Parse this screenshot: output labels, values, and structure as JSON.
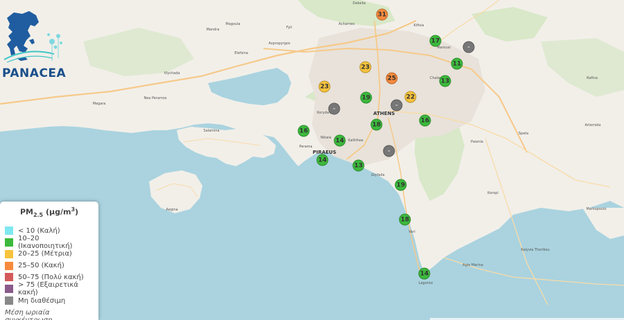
{
  "brand": {
    "name": "PANACEA"
  },
  "legend": {
    "title_main": "PM",
    "title_sub": "2.5",
    "title_unit_prefix": " (μg/m",
    "title_unit_sup": "3",
    "title_unit_suffix": ")",
    "items": [
      {
        "label": "< 10 (Καλή)",
        "color": "#7fe8f0"
      },
      {
        "label": "10–20 (Ικανοποιητική)",
        "color": "#3cb93c"
      },
      {
        "label": "20–25 (Μέτρια)",
        "color": "#f7c33c"
      },
      {
        "label": "25–50 (Κακή)",
        "color": "#f78a3c"
      },
      {
        "label": "50–75 (Πολύ κακή)",
        "color": "#d45a5a"
      },
      {
        "label": "> 75 (Εξαιρετικά κακή)",
        "color": "#8a5a8a"
      },
      {
        "label": "Μη διαθέσιμη",
        "color": "#888888"
      }
    ],
    "footer": "Μέση ωριαία συγκέντρωση"
  },
  "map": {
    "sea_color": "#aad3df",
    "land_color": "#f2efe9",
    "places": [
      {
        "label": "ATHENS",
        "major": true
      },
      {
        "label": "PIRAEUS",
        "major": true
      },
      {
        "label": "Megara",
        "major": false
      },
      {
        "label": "Elefsina",
        "major": false
      },
      {
        "label": "Salamina",
        "major": false
      },
      {
        "label": "Aegina",
        "major": false
      },
      {
        "label": "Marousi",
        "major": false
      },
      {
        "label": "Chalandri",
        "major": false
      },
      {
        "label": "Kallithea",
        "major": false
      },
      {
        "label": "Glyfada",
        "major": false
      },
      {
        "label": "Vari",
        "major": false
      },
      {
        "label": "Paiania",
        "major": false
      },
      {
        "label": "Spata",
        "major": false
      },
      {
        "label": "Koropi",
        "major": false
      },
      {
        "label": "Rafina",
        "major": false
      },
      {
        "label": "Artemida",
        "major": false
      },
      {
        "label": "Markopoulo",
        "major": false
      },
      {
        "label": "Kalyvia Thorikou",
        "major": false
      },
      {
        "label": "Agia Marina",
        "major": false
      },
      {
        "label": "Lagonisi",
        "major": false
      },
      {
        "label": "Nikaia",
        "major": false
      },
      {
        "label": "Korydallos",
        "major": false
      },
      {
        "label": "Perama",
        "major": false
      },
      {
        "label": "Aspropyrgos",
        "major": false
      },
      {
        "label": "Mandra",
        "major": false
      },
      {
        "label": "Magoula",
        "major": false
      },
      {
        "label": "Fyli",
        "major": false
      },
      {
        "label": "Acharnes",
        "major": false
      },
      {
        "label": "Dekelia",
        "major": false
      },
      {
        "label": "Kifisia",
        "major": false
      },
      {
        "label": "Nea Peramos",
        "major": false
      },
      {
        "label": "Vlychada",
        "major": false
      }
    ]
  },
  "markers": [
    {
      "value": "31",
      "color": "#f78a3c"
    },
    {
      "value": "17",
      "color": "#3cb93c"
    },
    {
      "value": "-",
      "color": "#777777"
    },
    {
      "value": "23",
      "color": "#f7c33c"
    },
    {
      "value": "11",
      "color": "#3cb93c"
    },
    {
      "value": "25",
      "color": "#f78a3c"
    },
    {
      "value": "23",
      "color": "#f7c33c"
    },
    {
      "value": "13",
      "color": "#3cb93c"
    },
    {
      "value": "19",
      "color": "#3cb93c"
    },
    {
      "value": "22",
      "color": "#f7c33c"
    },
    {
      "value": "-",
      "color": "#777777"
    },
    {
      "value": "-",
      "color": "#777777"
    },
    {
      "value": "16",
      "color": "#3cb93c"
    },
    {
      "value": "18",
      "color": "#3cb93c"
    },
    {
      "value": "16",
      "color": "#3cb93c"
    },
    {
      "value": "14",
      "color": "#3cb93c"
    },
    {
      "value": "-",
      "color": "#777777"
    },
    {
      "value": "14",
      "color": "#3cb93c"
    },
    {
      "value": "13",
      "color": "#3cb93c"
    },
    {
      "value": "19",
      "color": "#3cb93c"
    },
    {
      "value": "18",
      "color": "#3cb93c"
    },
    {
      "value": "14",
      "color": "#3cb93c"
    }
  ]
}
